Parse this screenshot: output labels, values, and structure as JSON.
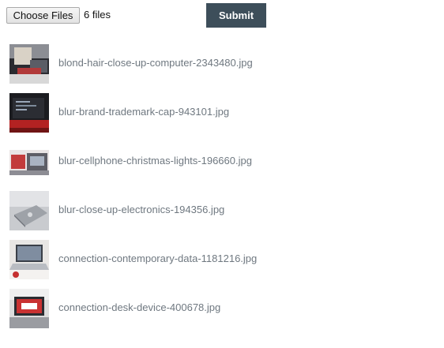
{
  "form": {
    "choose_label": "Choose Files",
    "file_count": "6 files",
    "submit_label": "Submit"
  },
  "files": [
    {
      "name": "blond-hair-close-up-computer-2343480.jpg"
    },
    {
      "name": "blur-brand-trademark-cap-943101.jpg"
    },
    {
      "name": "blur-cellphone-christmas-lights-196660.jpg"
    },
    {
      "name": "blur-close-up-electronics-194356.jpg"
    },
    {
      "name": "connection-contemporary-data-1181216.jpg"
    },
    {
      "name": "connection-desk-device-400678.jpg"
    }
  ]
}
